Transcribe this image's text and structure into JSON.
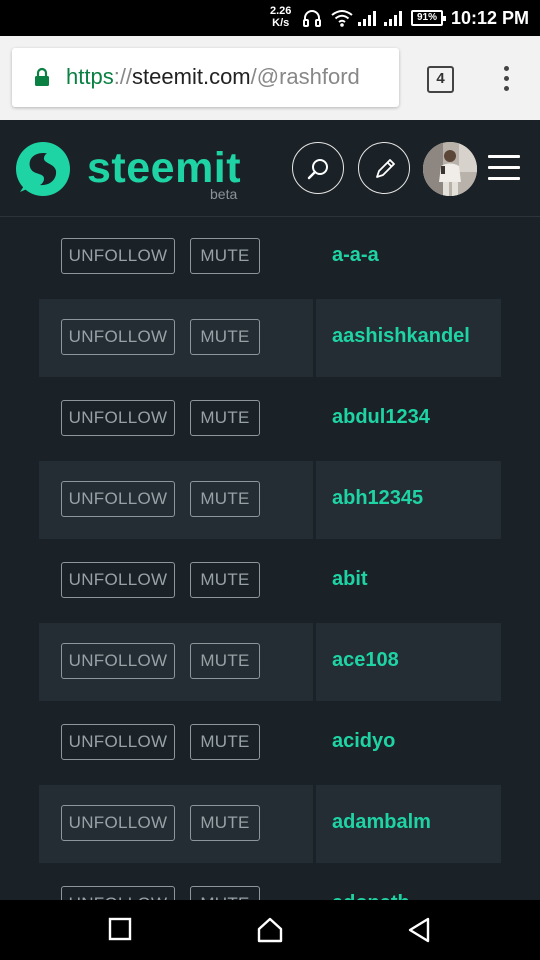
{
  "status_bar": {
    "net_speed_value": "2.26",
    "net_speed_unit": "K/s",
    "battery": "91%",
    "time": "10:12 PM"
  },
  "browser": {
    "url_scheme": "https",
    "url_sep": "://",
    "url_host": "steemit.com",
    "url_path": "/@rashford",
    "tab_count": "4"
  },
  "app_header": {
    "logo_text": "steemit",
    "logo_beta": "beta"
  },
  "follow_list": {
    "unfollow_label": "UNFOLLOW",
    "mute_label": "MUTE",
    "users": [
      "a-a-a",
      "aashishkandel",
      "abdul1234",
      "abh12345",
      "abit",
      "ace108",
      "acidyo",
      "adambalm",
      "adonath"
    ]
  },
  "colors": {
    "accent": "#1fd4a4",
    "background": "#1b2227",
    "row_alt": "#232d33"
  }
}
